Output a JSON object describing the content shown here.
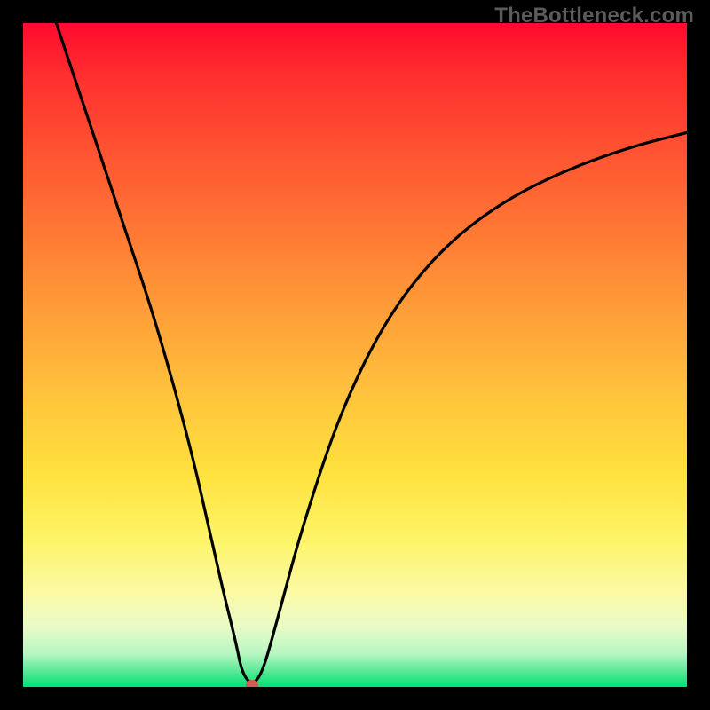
{
  "watermark": "TheBottleneck.com",
  "chart_data": {
    "type": "line",
    "title": "",
    "xlabel": "",
    "ylabel": "",
    "xlim": [
      0,
      100
    ],
    "ylim": [
      0,
      100
    ],
    "grid": false,
    "legend": false,
    "background_gradient": {
      "top": "#ff0a2e",
      "bottom": "#00e27a",
      "description": "vertical red-to-green spectrum"
    },
    "series": [
      {
        "name": "bottleneck-curve",
        "x": [
          5,
          10,
          15,
          20,
          25,
          28,
          30,
          32,
          33,
          34.5,
          36,
          38,
          42,
          48,
          55,
          63,
          72,
          82,
          92,
          100
        ],
        "y": [
          100,
          85,
          70,
          55,
          37,
          24,
          15,
          7,
          2,
          0.3,
          2,
          9,
          24,
          42,
          56,
          66,
          73,
          78,
          81.5,
          83.5
        ],
        "color": "#000000"
      }
    ],
    "annotations": [
      {
        "name": "min-marker",
        "x": 34.5,
        "y": 0.3,
        "color": "#d85a52"
      }
    ]
  }
}
